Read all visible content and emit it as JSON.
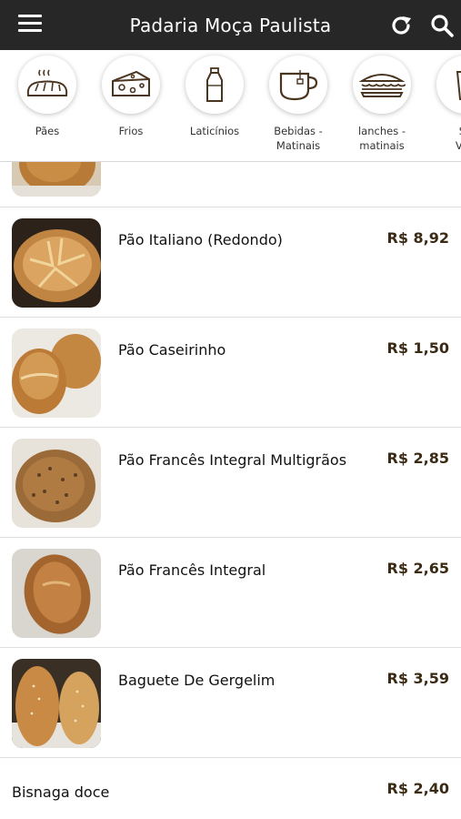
{
  "app": {
    "title": "Padaria Moça Paulista"
  },
  "categories": [
    {
      "label": "Pães",
      "icon": "bread-icon"
    },
    {
      "label": "Frios",
      "icon": "cheese-icon"
    },
    {
      "label": "Laticínios",
      "icon": "milk-bottle-icon"
    },
    {
      "label": "Bebidas -\nMatinais",
      "icon": "tea-cup-icon"
    },
    {
      "label": "lanches -\nmatinais",
      "icon": "sandwich-icon"
    },
    {
      "label": "Su\nVita",
      "icon": "cup-icon"
    }
  ],
  "products": [
    {
      "name": "Pão Italiano (Redondo)",
      "price": "R$ 8,92"
    },
    {
      "name": "Pão Caseirinho",
      "price": "R$ 1,50"
    },
    {
      "name": "Pão Francês Integral Multigrãos",
      "price": "R$ 2,85"
    },
    {
      "name": "Pão Francês Integral",
      "price": "R$ 2,65"
    },
    {
      "name": "Baguete De Gergelim",
      "price": "R$ 3,59"
    },
    {
      "name": "Bisnaga doce",
      "price": "R$ 2,40"
    }
  ],
  "colors": {
    "topbar": "#272727",
    "price": "#3b2a14",
    "icon_stroke": "#4a3520"
  }
}
